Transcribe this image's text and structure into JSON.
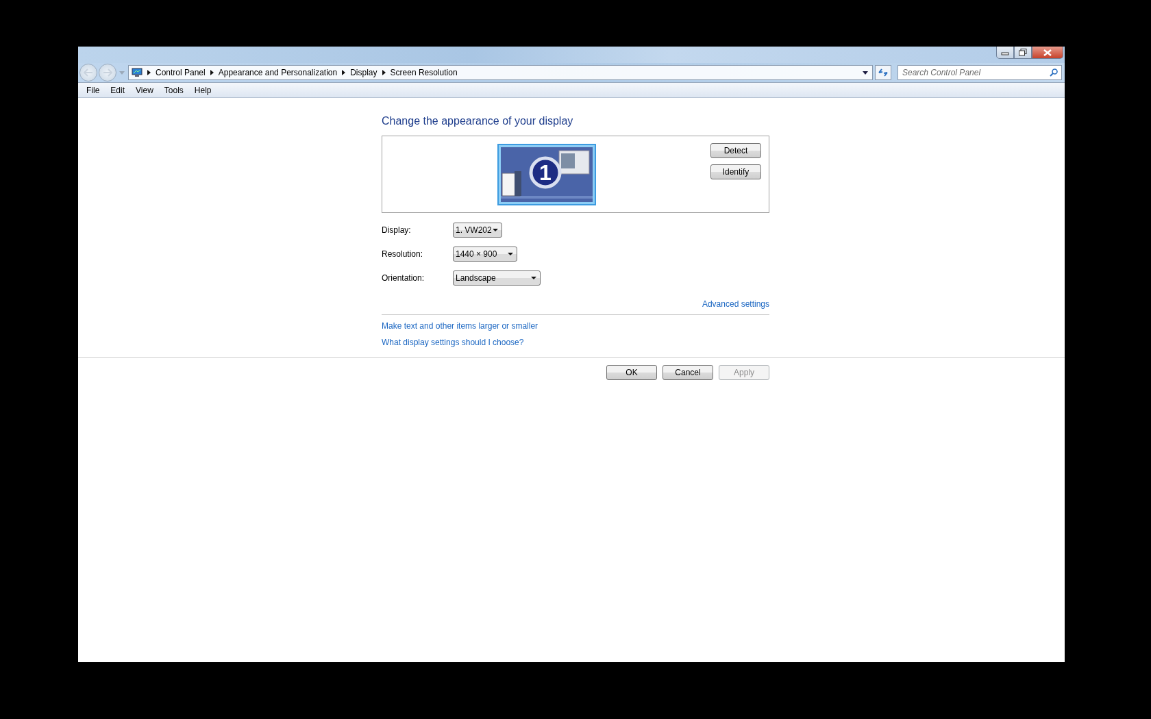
{
  "address_bar": {
    "breadcrumbs": [
      "Control Panel",
      "Appearance and Personalization",
      "Display",
      "Screen Resolution"
    ]
  },
  "search": {
    "placeholder": "Search Control Panel"
  },
  "menu": [
    "File",
    "Edit",
    "View",
    "Tools",
    "Help"
  ],
  "heading": "Change the appearance of your display",
  "monitor": {
    "number": "1",
    "selected": true
  },
  "monitor_buttons": [
    "Detect",
    "Identify"
  ],
  "settings": [
    {
      "label": "Display:",
      "value": "1. VW202"
    },
    {
      "label": "Resolution:",
      "value": "1440 × 900"
    },
    {
      "label": "Orientation:",
      "value": "Landscape"
    }
  ],
  "advanced_link": "Advanced settings",
  "help_links": [
    "Make text and other items larger or smaller",
    "What display settings should I choose?"
  ],
  "dialog_buttons": [
    {
      "label": "OK",
      "disabled": false
    },
    {
      "label": "Cancel",
      "disabled": false
    },
    {
      "label": "Apply",
      "disabled": true
    }
  ]
}
